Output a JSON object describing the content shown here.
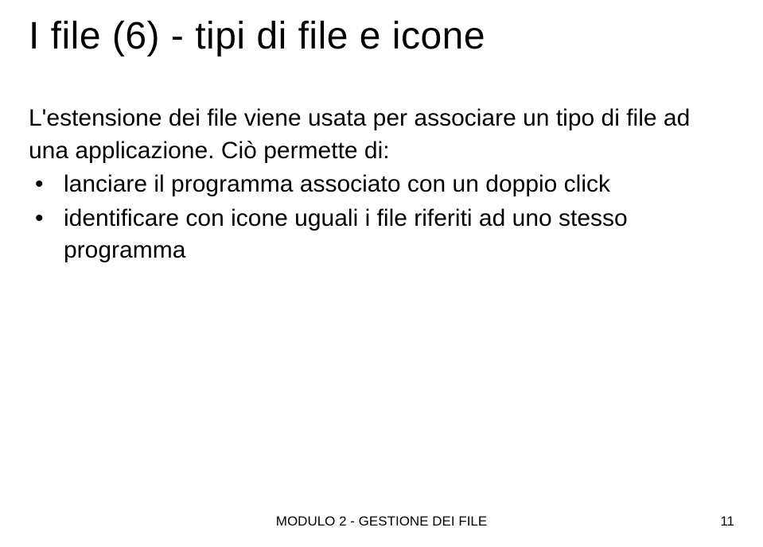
{
  "title": "I file (6) - tipi di file e icone",
  "intro": "L'estensione dei file viene usata per associare un tipo di file ad una applicazione. Ciò permette di:",
  "bullets": [
    "lanciare il programma associato con un doppio click",
    "identificare con icone uguali i file riferiti ad uno stesso programma"
  ],
  "footer": {
    "center": "MODULO 2 - GESTIONE DEI FILE",
    "page": "11"
  }
}
